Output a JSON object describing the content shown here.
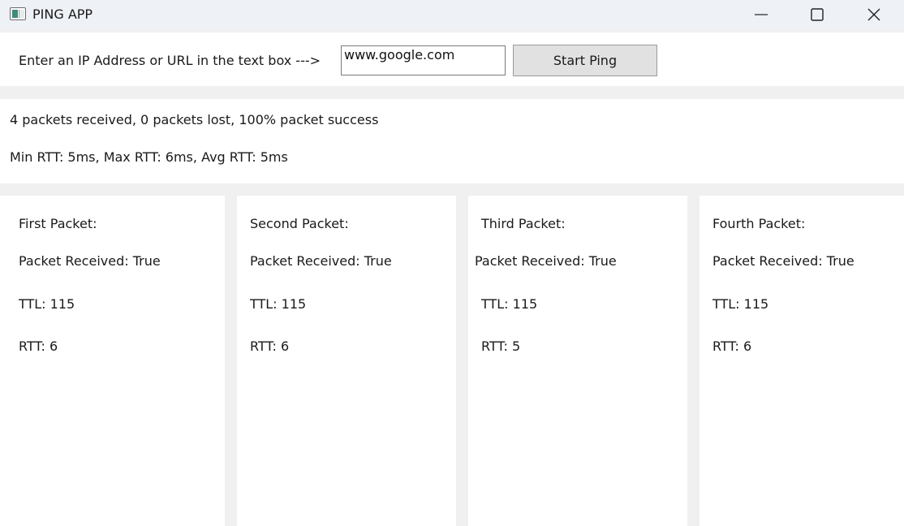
{
  "window": {
    "title": "PING APP",
    "icon": "app-window-icon",
    "controls": {
      "minimize_icon": "minimize-icon",
      "maximize_icon": "maximize-icon",
      "close_icon": "close-icon"
    }
  },
  "input_row": {
    "prompt": "Enter an IP Address or URL in the text box --->",
    "url_value": "www.google.com",
    "start_button_label": "Start Ping"
  },
  "summary": {
    "line1": "4 packets received, 0 packets lost, 100% packet success",
    "line2": "Min RTT: 5ms, Max RTT: 6ms, Avg RTT: 5ms"
  },
  "packets": [
    {
      "title": "First Packet:",
      "received": "Packet Received: True",
      "ttl": "TTL: 115",
      "rtt": "RTT: 6"
    },
    {
      "title": "Second Packet:",
      "received": "Packet Received: True",
      "ttl": "TTL: 115",
      "rtt": "RTT: 6"
    },
    {
      "title": "Third Packet:",
      "received": "Packet Received: True",
      "ttl": "TTL: 115",
      "rtt": "RTT: 5"
    },
    {
      "title": "Fourth Packet:",
      "received": "Packet Received: True",
      "ttl": "TTL: 115",
      "rtt": "RTT: 6"
    }
  ],
  "colors": {
    "window_background": "#f0f0f0",
    "titlebar": "#eef1f6",
    "panel": "#ffffff",
    "button": "#e1e1e1"
  }
}
